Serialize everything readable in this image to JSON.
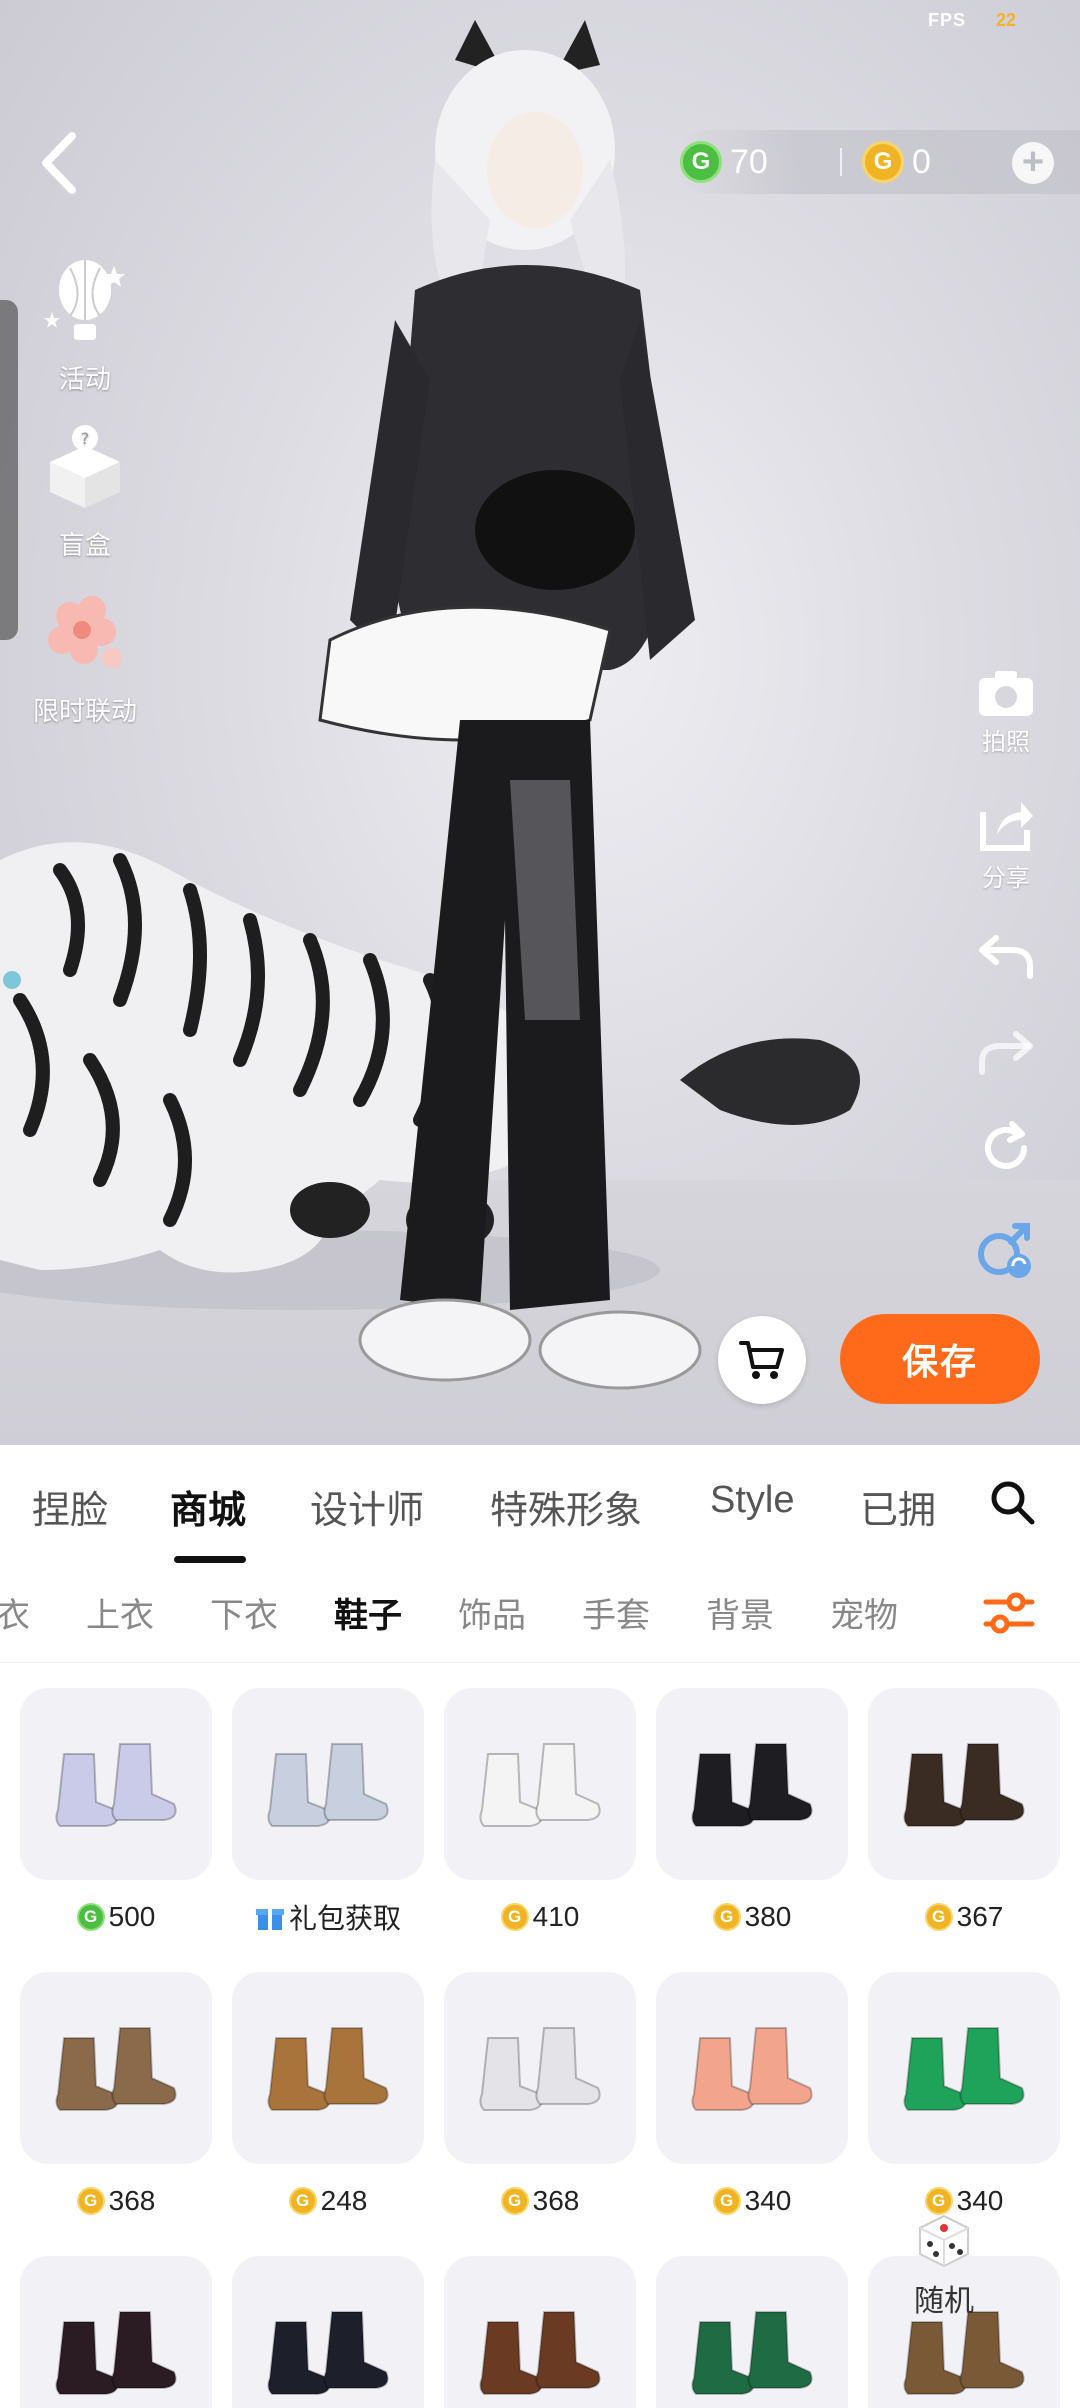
{
  "status": {
    "fps_label": "FPS",
    "fps_value": "22"
  },
  "currency": {
    "green_amount": "70",
    "gold_amount": "0",
    "green_symbol": "G",
    "gold_symbol": "G"
  },
  "side_left": [
    {
      "label": "活动",
      "icon": "balloon-icon"
    },
    {
      "label": "盲盒",
      "icon": "mystery-box-icon"
    },
    {
      "label": "限时联动",
      "icon": "flower-icon"
    }
  ],
  "side_right": [
    {
      "label": "拍照",
      "icon": "camera-icon"
    },
    {
      "label": "分享",
      "icon": "share-icon"
    },
    {
      "label": "",
      "icon": "undo-icon"
    },
    {
      "label": "",
      "icon": "redo-icon"
    },
    {
      "label": "",
      "icon": "reset-icon"
    },
    {
      "label": "",
      "icon": "gender-swap-icon"
    }
  ],
  "actions": {
    "save_label": "保存"
  },
  "tabs": [
    "捏脸",
    "商城",
    "设计师",
    "特殊形象",
    "Style",
    "已拥"
  ],
  "active_tab": "商城",
  "subtabs": [
    "衣",
    "上衣",
    "下衣",
    "鞋子",
    "饰品",
    "手套",
    "背景",
    "宠物"
  ],
  "active_subtab": "鞋子",
  "items": [
    {
      "price": "500",
      "currency": "green",
      "color": "#c9cbe8"
    },
    {
      "price": "礼包获取",
      "currency": "gift",
      "color": "#c8d0e0"
    },
    {
      "price": "410",
      "currency": "gold",
      "color": "#f4f4f4"
    },
    {
      "price": "380",
      "currency": "gold",
      "color": "#1d1d22"
    },
    {
      "price": "367",
      "currency": "gold",
      "color": "#3a2c22"
    },
    {
      "price": "368",
      "currency": "gold",
      "color": "#8a6a4a"
    },
    {
      "price": "248",
      "currency": "gold",
      "color": "#a8743c"
    },
    {
      "price": "368",
      "currency": "gold",
      "color": "#e4e4e8"
    },
    {
      "price": "340",
      "currency": "gold",
      "color": "#f2a48c"
    },
    {
      "price": "340",
      "currency": "gold",
      "color": "#1fa35a"
    },
    {
      "price": "",
      "currency": "none",
      "color": "#2a1c22"
    },
    {
      "price": "",
      "currency": "none",
      "color": "#1d1f2a"
    },
    {
      "price": "",
      "currency": "none",
      "color": "#6a3a22"
    },
    {
      "price": "",
      "currency": "none",
      "color": "#1f6b44"
    },
    {
      "price": "",
      "currency": "none",
      "color": "#7a5a36"
    }
  ],
  "random": {
    "label": "随机"
  }
}
